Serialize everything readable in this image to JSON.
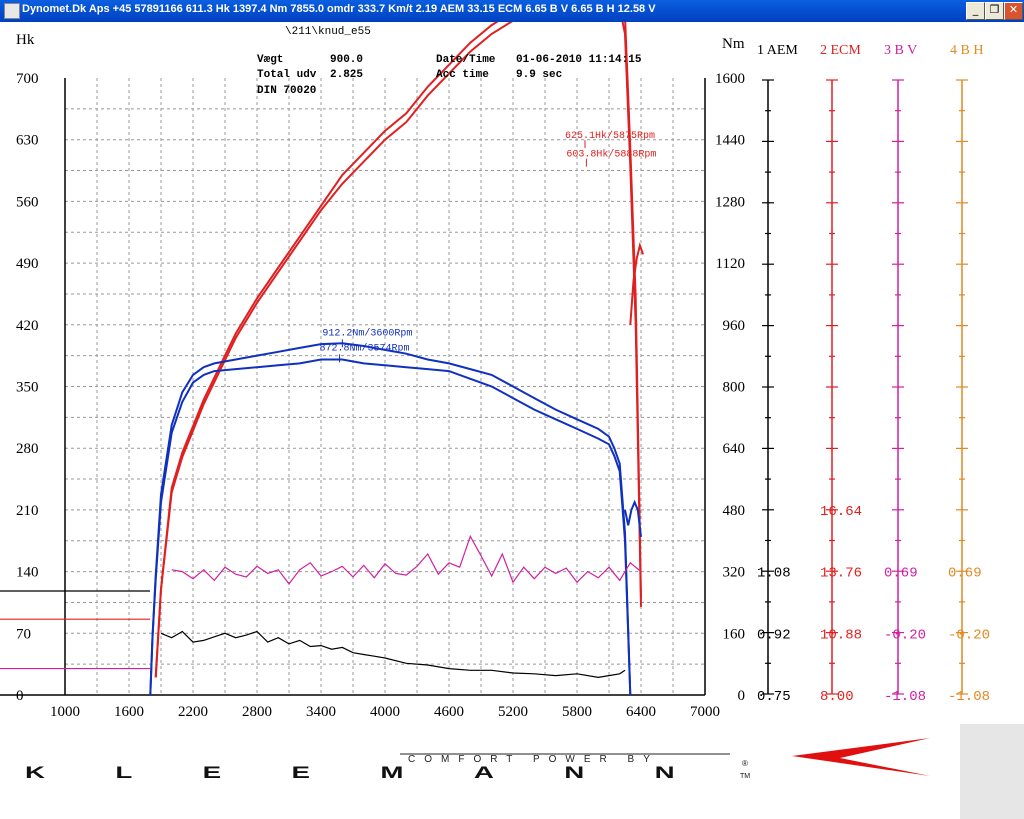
{
  "window": {
    "title": "Dynomet.Dk Aps +45 57891166  611.3 Hk 1397.4 Nm 7855.0 omdr 333.7 Km/t   2.19 AEM 33.15 ECM 6.65 B V 6.65 B H 12.58 V",
    "min_glyph": "_",
    "max_glyph": "❐",
    "close_glyph": "✕"
  },
  "header": {
    "file": "\\211\\knud_e55",
    "vaegt_label": "Vægt",
    "vaegt_value": "900.0",
    "total_label": "Total udv",
    "total_value": "2.825",
    "din_label": "DIN 70020",
    "date_label": "Date/Time",
    "date_value": "01-06-2010 11:14:15",
    "acc_label": "Acc time",
    "acc_value": "9.9 sec"
  },
  "colors": {
    "red": "#e02020",
    "blue": "#1030c0",
    "magenta": "#d020a0",
    "black": "#000000",
    "orange": "#e08a20",
    "grid": "#999999"
  },
  "chart_data": {
    "type": "line",
    "xlabel": "",
    "ylabel": "Hk",
    "y2label": "Nm",
    "xlim": [
      1000,
      7000
    ],
    "ylim": [
      0,
      700
    ],
    "y2lim": [
      0,
      1600
    ],
    "xticks": [
      "1000",
      "1600",
      "2200",
      "2800",
      "3400",
      "4000",
      "4600",
      "5200",
      "5800",
      "6400",
      "7000"
    ],
    "yticks": [
      "0",
      "70",
      "140",
      "210",
      "280",
      "350",
      "420",
      "490",
      "560",
      "630",
      "700"
    ],
    "y2ticks": [
      "0",
      "160",
      "320",
      "480",
      "640",
      "800",
      "960",
      "1120",
      "1280",
      "1440",
      "1600"
    ],
    "grid": true,
    "series": [
      {
        "axis": "left",
        "color": "red",
        "x": [
          1850,
          1900,
          2000,
          2100,
          2200,
          2300,
          2400,
          2500,
          2600,
          2800,
          3000,
          3200,
          3400,
          3600,
          3800,
          4000,
          4200,
          4400,
          4600,
          4800,
          5000,
          5200,
          5400,
          5600,
          5800,
          5900,
          6000,
          6100,
          6150,
          6200,
          6250,
          6300,
          6350,
          6400
        ],
        "y": [
          20,
          120,
          230,
          270,
          300,
          330,
          355,
          380,
          405,
          445,
          480,
          515,
          550,
          580,
          605,
          630,
          650,
          680,
          705,
          730,
          750,
          765,
          780,
          790,
          800,
          800,
          805,
          805,
          800,
          780,
          750,
          600,
          420,
          100
        ]
      },
      {
        "axis": "left",
        "color": "red",
        "x": [
          1850,
          1900,
          2000,
          2100,
          2200,
          2300,
          2400,
          2500,
          2600,
          2800,
          3000,
          3200,
          3400,
          3600,
          3800,
          4000,
          4200,
          4400,
          4600,
          4800,
          5000,
          5200,
          5400,
          5600,
          5800,
          5900,
          6000,
          6100,
          6150,
          6200,
          6250,
          6300,
          6350,
          6400
        ],
        "y": [
          20,
          120,
          235,
          275,
          305,
          335,
          360,
          385,
          410,
          450,
          485,
          520,
          555,
          590,
          615,
          640,
          660,
          690,
          715,
          740,
          760,
          775,
          790,
          800,
          815,
          820,
          825,
          825,
          820,
          800,
          770,
          620,
          450,
          110
        ]
      },
      {
        "axis": "left",
        "color": "red",
        "x": [
          6300,
          6330,
          6360,
          6390,
          6420
        ],
        "y": [
          420,
          470,
          495,
          510,
          500
        ]
      },
      {
        "axis": "right",
        "color": "blue",
        "x": [
          1800,
          1820,
          1850,
          1900,
          2000,
          2100,
          2200,
          2300,
          2400,
          2600,
          2800,
          3000,
          3200,
          3400,
          3600,
          3800,
          4000,
          4200,
          4400,
          4600,
          4800,
          5000,
          5200,
          5400,
          5600,
          5800,
          6000,
          6100,
          6150,
          6200,
          6250,
          6300
        ],
        "y": [
          0,
          150,
          300,
          500,
          680,
          760,
          810,
          830,
          840,
          845,
          850,
          855,
          860,
          870,
          870,
          860,
          855,
          850,
          845,
          840,
          820,
          800,
          770,
          740,
          715,
          690,
          665,
          650,
          620,
          580,
          400,
          0
        ]
      },
      {
        "axis": "right",
        "color": "blue",
        "x": [
          1800,
          1820,
          1850,
          1900,
          2000,
          2100,
          2200,
          2300,
          2400,
          2600,
          2800,
          3000,
          3200,
          3400,
          3600,
          3800,
          4000,
          4200,
          4400,
          4600,
          4800,
          5000,
          5200,
          5400,
          5600,
          5800,
          6000,
          6100,
          6150,
          6200,
          6250,
          6300
        ],
        "y": [
          0,
          150,
          310,
          520,
          700,
          785,
          830,
          850,
          860,
          870,
          880,
          890,
          900,
          910,
          912,
          905,
          895,
          885,
          870,
          860,
          845,
          830,
          800,
          770,
          740,
          715,
          690,
          670,
          640,
          600,
          420,
          0
        ]
      },
      {
        "axis": "right",
        "color": "blue",
        "x": [
          6250,
          6280,
          6310,
          6340,
          6370,
          6400
        ],
        "y": [
          480,
          440,
          480,
          500,
          480,
          410
        ]
      },
      {
        "axis": "left",
        "color": "magenta",
        "x": [
          2000,
          2100,
          2200,
          2300,
          2400,
          2500,
          2600,
          2700,
          2800,
          2900,
          3000,
          3100,
          3200,
          3300,
          3400,
          3500,
          3600,
          3700,
          3800,
          3900,
          4000,
          4100,
          4200,
          4300,
          4400,
          4500,
          4600,
          4700,
          4800,
          4900,
          5000,
          5100,
          5200,
          5300,
          5400,
          5500,
          5600,
          5700,
          5800,
          5900,
          6000,
          6100,
          6200,
          6300,
          6400
        ],
        "y": [
          142,
          140,
          132,
          142,
          130,
          145,
          137,
          134,
          146,
          138,
          142,
          126,
          142,
          150,
          135,
          140,
          146,
          134,
          147,
          133,
          149,
          138,
          136,
          146,
          160,
          137,
          150,
          145,
          180,
          158,
          135,
          160,
          128,
          145,
          132,
          145,
          138,
          144,
          128,
          140,
          133,
          145,
          130,
          150,
          140
        ]
      },
      {
        "axis": "left",
        "color": "black",
        "x": [
          1900,
          2000,
          2100,
          2200,
          2300,
          2400,
          2500,
          2600,
          2700,
          2800,
          2900,
          3000,
          3100,
          3200,
          3300,
          3400,
          3500,
          3600,
          3700,
          3800,
          3900,
          4000,
          4200,
          4400,
          4600,
          4800,
          5000,
          5200,
          5400,
          5600,
          5800,
          6000,
          6100,
          6200,
          6250
        ],
        "y": [
          70,
          65,
          72,
          60,
          62,
          66,
          70,
          65,
          68,
          72,
          60,
          65,
          58,
          62,
          55,
          56,
          52,
          54,
          48,
          46,
          44,
          42,
          36,
          34,
          30,
          28,
          28,
          25,
          24,
          22,
          24,
          20,
          22,
          24,
          28
        ]
      }
    ],
    "annotations": [
      {
        "text": "625.1Hk/5875Rpm",
        "color": "red",
        "x": 5875,
        "y": 625
      },
      {
        "text": "603.8Hk/5888Rpm",
        "color": "red",
        "x": 5888,
        "y": 604
      },
      {
        "text": "912.2Nm/3600Rpm",
        "color": "blue",
        "x": 3600,
        "y2": 912
      },
      {
        "text": "872.8Nm/3574Rpm",
        "color": "blue",
        "x": 3574,
        "y2": 873
      }
    ],
    "side_scales": [
      {
        "label": "1 AEM",
        "color": "black",
        "values": [
          "1.08",
          "0.92",
          "0.75"
        ]
      },
      {
        "label": "2 ECM",
        "color": "red",
        "values": [
          "16.64",
          "13.76",
          "10.88",
          "8.00"
        ]
      },
      {
        "label": "3 B V",
        "color": "magenta",
        "values": [
          "0.69",
          "-0.20",
          "-1.08"
        ]
      },
      {
        "label": "4 B H",
        "color": "orange",
        "values": [
          "0.69",
          "-0.20",
          "-1.08"
        ]
      }
    ],
    "left_markers": [
      {
        "color": "black",
        "y": 118
      },
      {
        "color": "red",
        "y": 86
      },
      {
        "color": "magenta",
        "y": 30
      }
    ]
  },
  "footer": {
    "brand": "KLEEMANN",
    "slogan": "COMFORT POWER BY",
    "reg": "®",
    "tm": "TM"
  }
}
